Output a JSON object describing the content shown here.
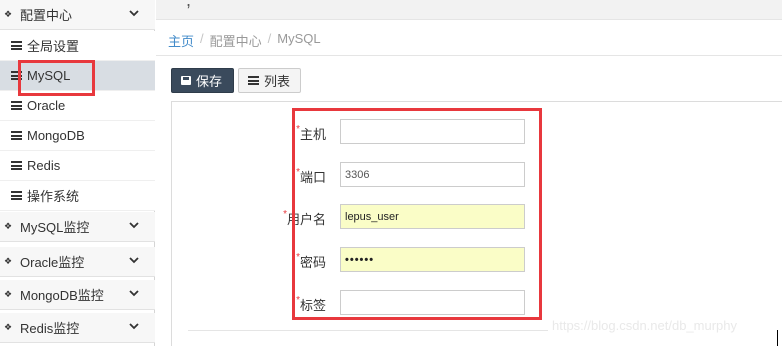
{
  "sidebar": {
    "groups": [
      {
        "label": "配置中心"
      },
      {
        "label": "MySQL监控"
      },
      {
        "label": "Oracle监控"
      },
      {
        "label": "MongoDB监控"
      },
      {
        "label": "Redis监控"
      }
    ],
    "items": [
      {
        "label": "全局设置"
      },
      {
        "label": "MySQL"
      },
      {
        "label": "Oracle"
      },
      {
        "label": "MongoDB"
      },
      {
        "label": "Redis"
      },
      {
        "label": "操作系统"
      }
    ]
  },
  "breadcrumb": {
    "home": "主页",
    "sep": "/",
    "section": "配置中心",
    "page": "MySQL"
  },
  "toolbar": {
    "save_label": "保存",
    "list_label": "列表"
  },
  "form": {
    "required_mark": "*",
    "host": {
      "label": "主机",
      "value": ""
    },
    "port": {
      "label": "端口",
      "value": "3306"
    },
    "username": {
      "label": "用户名",
      "value": "lepus_user"
    },
    "password": {
      "label": "密码",
      "value": "••••••"
    },
    "tags": {
      "label": "标签",
      "value": ""
    }
  },
  "watermark": "https://blog.csdn.net/db_murphy",
  "colors": {
    "highlight_box": "#e8383d",
    "save_button": "#3a4a5c",
    "link": "#428bca",
    "autofill": "#fafdc7"
  }
}
